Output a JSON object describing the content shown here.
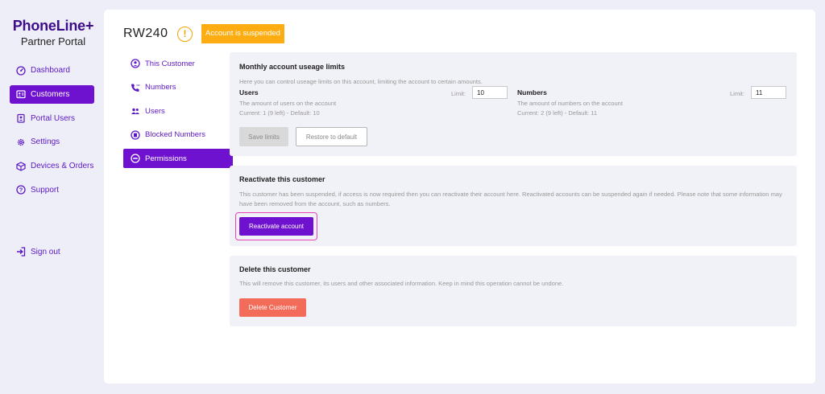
{
  "brand": {
    "name": "PhoneLine+",
    "subtitle": "Partner Portal"
  },
  "sidebar": {
    "items": [
      {
        "label": "Dashboard",
        "icon": "dashboard-icon",
        "active": false
      },
      {
        "label": "Customers",
        "icon": "customers-icon",
        "active": true
      },
      {
        "label": "Portal Users",
        "icon": "portal-users-icon",
        "active": false
      },
      {
        "label": "Settings",
        "icon": "gear-icon",
        "active": false
      },
      {
        "label": "Devices & Orders",
        "icon": "box-icon",
        "active": false
      },
      {
        "label": "Support",
        "icon": "help-icon",
        "active": false
      }
    ],
    "signout": "Sign out"
  },
  "header": {
    "title": "RW240",
    "warning_glyph": "!",
    "status_badge": "Account is suspended"
  },
  "subnav": {
    "items": [
      {
        "label": "This Customer",
        "icon": "user-circle-icon",
        "active": false
      },
      {
        "label": "Numbers",
        "icon": "phone-icon",
        "active": false
      },
      {
        "label": "Users",
        "icon": "users-icon",
        "active": false
      },
      {
        "label": "Blocked Numbers",
        "icon": "blocked-icon",
        "active": false
      },
      {
        "label": "Permissions",
        "icon": "minus-circle-icon",
        "active": true
      }
    ]
  },
  "limits": {
    "title": "Monthly account useage limits",
    "description": "Here you can control useage limits on this account, limiting the account to certain amounts.",
    "users": {
      "label": "Users",
      "description": "The amount of users on the account",
      "current": "Current: 1 (9 left) - Default: 10",
      "limit_label": "Limit:",
      "limit_value": "10"
    },
    "numbers": {
      "label": "Numbers",
      "description": "The amount of numbers on the account",
      "current": "Current: 2 (9 left) - Default: 11",
      "limit_label": "Limit:",
      "limit_value": "11"
    },
    "save_label": "Save limits",
    "restore_label": "Restore to default"
  },
  "reactivate": {
    "title": "Reactivate this customer",
    "description": "This customer has been suspended, if access is now required then you can reactivate their account here. Reactivated accounts can be suspended again if needed. Please note that some information may have been removed from the account, such as numbers.",
    "button_label": "Reactivate account"
  },
  "delete": {
    "title": "Delete this customer",
    "description": "This will remove this customer, its users and other associated information. Keep in mind this operation cannot be undone.",
    "button_label": "Delete Customer"
  },
  "colors": {
    "accent": "#6f12cf",
    "brand": "#3d0d8a",
    "warning": "#fdad12",
    "danger": "#f36c5a",
    "focus": "#e544b8"
  }
}
